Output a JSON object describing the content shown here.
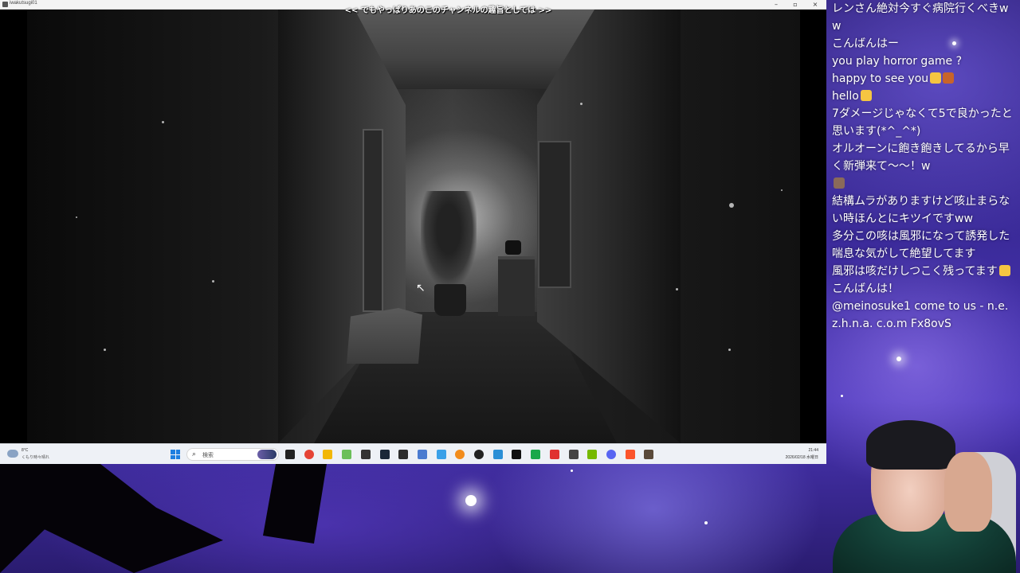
{
  "window": {
    "title": "iwakutsugi01",
    "controls": {
      "minimize": "–",
      "maximize": "▫",
      "close": "×"
    }
  },
  "game": {
    "subtitle": "<< でもやっぱりあのこのチャンネルの趣旨としては >>",
    "cursor_icon": "mouse-pointer"
  },
  "taskbar": {
    "weather_temp": "8°C",
    "weather_desc": "くもり時々晴れ",
    "search_label": "検索",
    "clock_time": "21:44",
    "clock_date": "2026/02/18 水曜日",
    "icons": [
      {
        "name": "task-view-icon",
        "color": "#222222"
      },
      {
        "name": "chrome-icon",
        "color": "#e54335"
      },
      {
        "name": "file-explorer-icon",
        "color": "#f2b705"
      },
      {
        "name": "vim-icon",
        "color": "#6bbf59"
      },
      {
        "name": "obs-icon",
        "color": "#333333"
      },
      {
        "name": "steam-icon",
        "color": "#1b2838"
      },
      {
        "name": "terminal-icon",
        "color": "#2d2d2d"
      },
      {
        "name": "photos-icon",
        "color": "#4a7bd0"
      },
      {
        "name": "snipping-tool-icon",
        "color": "#3aa0e8"
      },
      {
        "name": "app-icon-orange",
        "color": "#f28c1c"
      },
      {
        "name": "media-player-icon",
        "color": "#222222"
      },
      {
        "name": "calculator-icon",
        "color": "#2b8fd6"
      },
      {
        "name": "capcut-icon",
        "color": "#111111"
      },
      {
        "name": "app-icon-green",
        "color": "#19a84a"
      },
      {
        "name": "app-icon-red",
        "color": "#e03030"
      },
      {
        "name": "davinci-icon",
        "color": "#444444"
      },
      {
        "name": "nvidia-icon",
        "color": "#76b900"
      },
      {
        "name": "discord-icon",
        "color": "#5865f2"
      },
      {
        "name": "brave-icon",
        "color": "#fb542b"
      },
      {
        "name": "game-icon",
        "color": "#5a4a3a"
      }
    ]
  },
  "chat": {
    "messages": [
      {
        "text": "レンさん絶対今すぐ病院行くべきww",
        "emojis": []
      },
      {
        "text": "こんばんはー",
        "emojis": []
      },
      {
        "text": "you play horror game ?",
        "emojis": []
      },
      {
        "text": "happy to see you",
        "emojis": [
          "#f5c542",
          "#c8642a"
        ]
      },
      {
        "text": "hello",
        "emojis": [
          "#f5c542"
        ]
      },
      {
        "text": "7ダメージじゃなくて5で良かったと思います(*^_^*)",
        "emojis": []
      },
      {
        "text": "オルオーンに飽き飽きしてるから早く新弾来て〜〜！w",
        "emojis": []
      },
      {
        "text": "",
        "emojis": [
          "#8a6a5a"
        ]
      },
      {
        "text": "結構ムラがありますけど咳止まらない時ほんとにキツイですww",
        "emojis": []
      },
      {
        "text": "多分この咳は風邪になって誘発した喘息な気がして絶望してます",
        "emojis": []
      },
      {
        "text": "風邪は咳だけしつこく残ってます",
        "emojis": [
          "#f5c542"
        ]
      },
      {
        "text": "こんばんは！",
        "emojis": []
      },
      {
        "text": "@meinosuke1 come to us - n.e.z.h.n.a. c.o.m Fx8ovS",
        "emojis": []
      }
    ]
  }
}
